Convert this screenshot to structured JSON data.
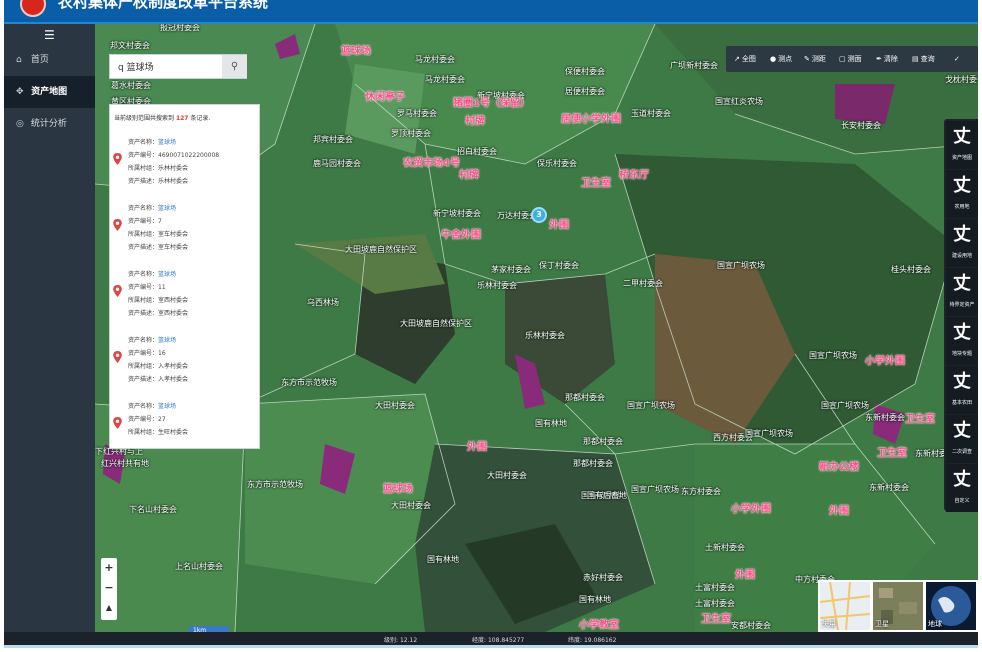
{
  "header": {
    "title": "农村集体产权制度改革平台系统"
  },
  "sidebar": {
    "items": [
      {
        "label": "首页",
        "icon": "home-icon"
      },
      {
        "label": "资产地图",
        "icon": "crosshair-icon",
        "active": true
      },
      {
        "label": "统计分析",
        "icon": "target-icon"
      }
    ]
  },
  "search": {
    "placeholder": "请输入",
    "value": "q 篮球场"
  },
  "results": {
    "summary_prefix": "当前级别范围共搜索到",
    "count": "127",
    "summary_suffix": "条记录.",
    "labels": {
      "name": "资产名称：",
      "number": "资产编号：",
      "org": "所属村组：",
      "desc": "资产描述："
    },
    "records": [
      {
        "name": "篮球场",
        "number": "4690071022200008",
        "org": "乐林村委会",
        "desc": "乐林村委会"
      },
      {
        "name": "篮球场",
        "number": "7",
        "org": "室车村委会",
        "desc": "室车村委会"
      },
      {
        "name": "篮球场",
        "number": "11",
        "org": "室西村委会",
        "desc": "室西村委会"
      },
      {
        "name": "篮球场",
        "number": "16",
        "org": "入孝村委会",
        "desc": "入孝村委会"
      },
      {
        "name": "篮球场",
        "number": "27",
        "org": "生旺村委会",
        "desc": ""
      }
    ]
  },
  "toolbar": {
    "tools": [
      {
        "label": "全图",
        "icon": "fullextent-icon"
      },
      {
        "label": "测点",
        "icon": "pin-icon"
      },
      {
        "label": "测距",
        "icon": "ruler-icon"
      },
      {
        "label": "测面",
        "icon": "area-icon"
      },
      {
        "label": "清除",
        "icon": "eraser-icon"
      },
      {
        "label": "查询",
        "icon": "query-icon"
      }
    ],
    "confirm_icon": "check-icon"
  },
  "layers": [
    {
      "label": "资产地图"
    },
    {
      "label": "农用地"
    },
    {
      "label": "建设用地"
    },
    {
      "label": "待界定资产"
    },
    {
      "label": "地块专题"
    },
    {
      "label": "基本农田"
    },
    {
      "label": "二次调查"
    },
    {
      "label": "自定义"
    }
  ],
  "zoom": {
    "in": "+",
    "out": "−",
    "north": "▲"
  },
  "basemaps": [
    {
      "label": "矢量",
      "color": "#e8eef2"
    },
    {
      "label": "卫星",
      "color": "#7b7f5a"
    },
    {
      "label": "地球",
      "color": "#2a5a9a"
    }
  ],
  "scale": "1km",
  "status": {
    "level_label": "级别",
    "level": "12.12",
    "lng_label": "经度",
    "lng": "108.845277",
    "lat_label": "纬度",
    "lat": "19.086162"
  },
  "map": {
    "cluster_count": "3",
    "places": [
      "报冠村委会",
      "邦文村委会",
      "葛水村委会",
      "黄区村委会",
      "邦宾村委会",
      "鹿马园村委会",
      "罗顶村委会",
      "大田坡鹿自然保护区",
      "乌西林场",
      "大田坡鹿自然保护区",
      "东方市示范牧场",
      "大田村委会",
      "东方市示范牧场",
      "下红兴村与上",
      "红兴村共有地",
      "下名山村委会",
      "上名山村委会",
      "马龙村委会",
      "马龙村委会",
      "罗马村委会",
      "新宁坡村委会",
      "万达村委会",
      "招白村委会",
      "保乐村委会",
      "居便村委会",
      "保便村委会",
      "新宁坡村委会",
      "广坝新村委会",
      "玉道村委会",
      "保丁村委会",
      "茅家村委会",
      "乐林村委会",
      "乐林村委会",
      "那都村委会",
      "国有林地",
      "那都村委会",
      "那都村委会",
      "国有坡林地",
      "大田村委会",
      "大田村委会",
      "国有林地",
      "国有后畜地",
      "国宣广坝农场",
      "西方村委会",
      "东方村委会",
      "土新村委会",
      "赤好村委会",
      "国有林地",
      "土富村委会",
      "安都村委会",
      "国宣红炎农场",
      "长安村委会",
      "桂头村委会",
      "二甲村委会",
      "国宣广坝农场",
      "国宣广坝农场",
      "国宣广坝农场",
      "东新村委会",
      "东新村委会",
      "中方村委会",
      "戈枕村委会",
      "东新村委会",
      "土富村委会",
      "国宣广坝农场",
      "国宣广坝农场"
    ],
    "pois": [
      "篮球场",
      "休闲亭子",
      "猪圈1号（保留）",
      "村牌",
      "居便小学外围",
      "农贸市场4号",
      "村牌",
      "牛舍外围",
      "卫生室",
      "桥东厅",
      "外围",
      "外围",
      "篮球场",
      "小学外围",
      "外围",
      "新办公楼",
      "卫生室",
      "小学外围",
      "外围",
      "卫生室",
      "卫生室",
      "小学教室",
      "村牌"
    ]
  }
}
